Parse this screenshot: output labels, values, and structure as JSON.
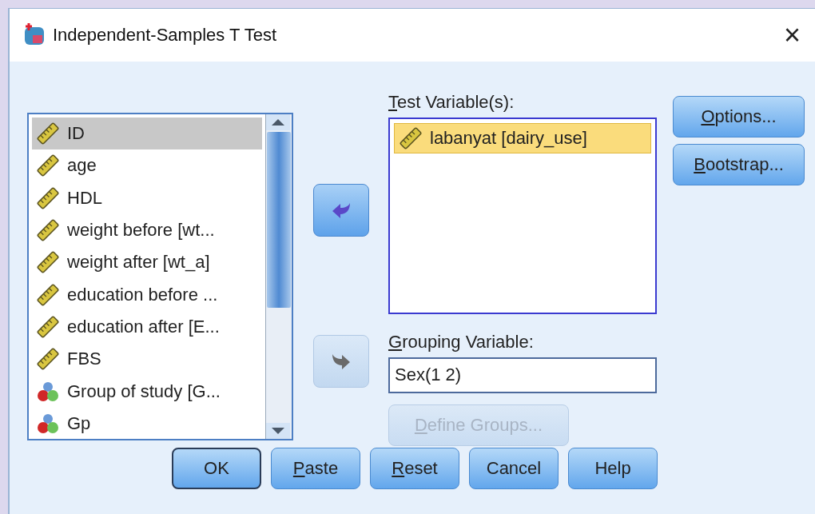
{
  "window": {
    "title": "Independent-Samples T Test",
    "close": "×"
  },
  "variables": [
    {
      "label": "ID",
      "kind": "scale",
      "selected": true
    },
    {
      "label": "age",
      "kind": "scale",
      "selected": false
    },
    {
      "label": "HDL",
      "kind": "scale",
      "selected": false
    },
    {
      "label": "weight before [wt...",
      "kind": "scale",
      "selected": false
    },
    {
      "label": "weight after [wt_a]",
      "kind": "scale",
      "selected": false
    },
    {
      "label": "education before ...",
      "kind": "scale",
      "selected": false
    },
    {
      "label": "education after [E...",
      "kind": "scale",
      "selected": false
    },
    {
      "label": "FBS",
      "kind": "scale",
      "selected": false
    },
    {
      "label": "Group of study [G...",
      "kind": "nominal",
      "selected": false
    },
    {
      "label": "Gp",
      "kind": "nominal",
      "selected": false
    }
  ],
  "move_buttons": [
    {
      "kind": "left",
      "disabled": false
    },
    {
      "kind": "right",
      "disabled": true
    }
  ],
  "test_variables": {
    "label": "Test Variable(s):",
    "underline_first": true,
    "items": [
      {
        "label": "labanyat [dairy_use]",
        "kind": "scale",
        "selected": true
      }
    ]
  },
  "grouping_variable": {
    "label": "Grouping Variable:",
    "underline_first": true,
    "value": "Sex(1 2)"
  },
  "define_groups": {
    "label": "Define Groups...",
    "underline_first": true,
    "disabled": true
  },
  "side_buttons": [
    {
      "label": "Options...",
      "underline_first": true
    },
    {
      "label": "Bootstrap...",
      "underline_first": true
    }
  ],
  "buttons": [
    {
      "label": "OK",
      "underline_first": false,
      "default": true
    },
    {
      "label": "Paste",
      "underline_first": true,
      "default": false
    },
    {
      "label": "Reset",
      "underline_first": true,
      "default": false
    },
    {
      "label": "Cancel",
      "underline_first": false,
      "default": false
    },
    {
      "label": "Help",
      "underline_first": false,
      "default": false
    }
  ]
}
